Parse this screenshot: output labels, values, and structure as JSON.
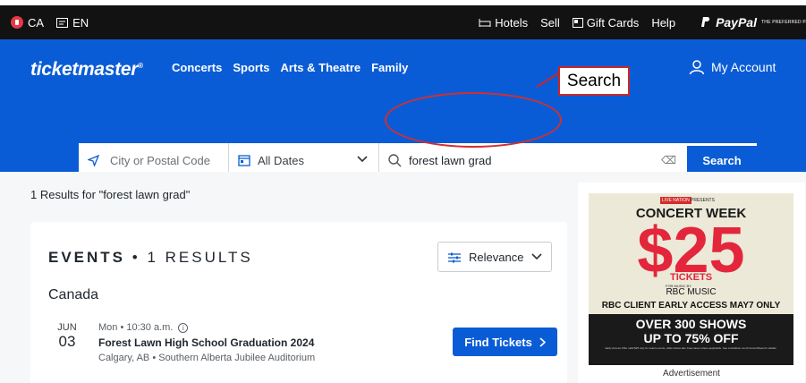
{
  "util_bar": {
    "country": "CA",
    "language": "EN",
    "links": [
      "Hotels",
      "Sell",
      "Gift Cards",
      "Help"
    ],
    "paypal_word": "PayPal",
    "paypal_tagline": "THE PREFERRED PAYMENTS PARTNER"
  },
  "header": {
    "logo": "ticketmaster",
    "nav": [
      "Concerts",
      "Sports",
      "Arts & Theatre",
      "Family"
    ],
    "account": "My Account"
  },
  "annotation": {
    "label": "Search"
  },
  "search": {
    "city_placeholder": "City or Postal Code",
    "dates": "All Dates",
    "query": "forest lawn grad",
    "button": "Search"
  },
  "results": {
    "count_text": "1 Results for \"forest lawn grad\"",
    "events_label": "EVENTS",
    "events_count": "1 RESULTS",
    "sort": "Relevance",
    "region": "Canada"
  },
  "event": {
    "month": "JUN",
    "day": "03",
    "time": "Mon • 10:30 a.m.",
    "name": "Forest Lawn High School Graduation 2024",
    "venue": "Calgary, AB • Southern Alberta Jubilee Auditorium",
    "button": "Find Tickets"
  },
  "ad": {
    "live_nation": "LIVE NATION",
    "presents": "PRESENTS",
    "headline": "CONCERT WEEK",
    "price": "$25",
    "tickets": "TICKETS",
    "presented_for": "FOR MUSIC BY",
    "sponsor": "RBC MUSIC",
    "early_access": "RBC CLIENT EARLY ACCESS MAY7 ONLY",
    "over": "OVER 300 SHOWS",
    "discount": "UP TO 75% OFF",
    "fine_print": "Early Access Offer valid $25 only for select events, while tickets last. Fees taxes where applicable. See LiveNation.com/ConcertWeek for details.",
    "label": "Advertisement"
  },
  "colors": {
    "brand_blue": "#0a5cd6",
    "annotation_red": "#c62828",
    "ad_red": "#e3263b"
  }
}
